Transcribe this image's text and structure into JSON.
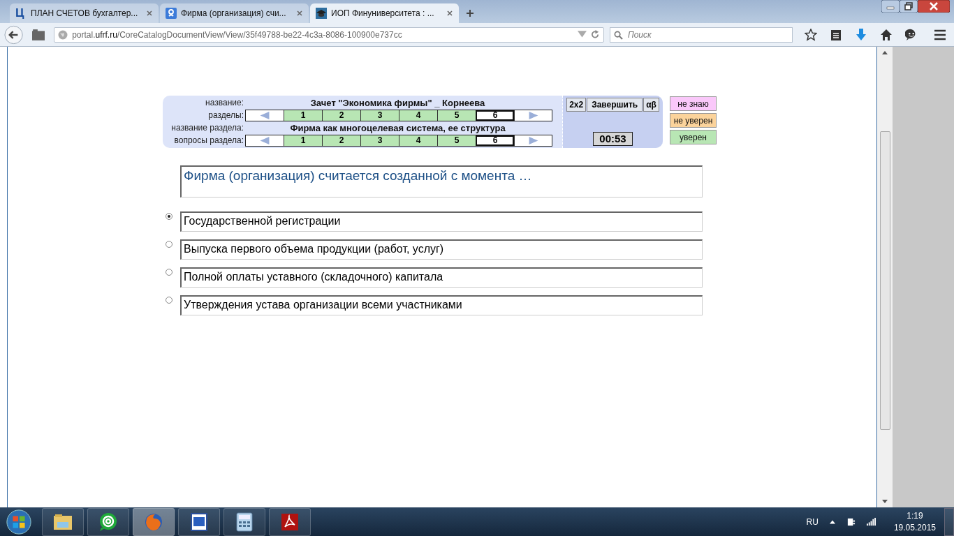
{
  "browser": {
    "tabs": [
      {
        "kind": "letter",
        "favicon_text": "Ц",
        "title": "ПЛАН СЧЕТОВ бухгалтер...",
        "selected": false
      },
      {
        "kind": "search",
        "title": "Фирма (организация) счи...",
        "selected": false
      },
      {
        "kind": "cap",
        "title": "ИОП Финуниверситета : ...",
        "selected": true
      }
    ],
    "url_prefix": "portal.",
    "url_host": "ufrf.ru",
    "url_path": "/CoreCatalogDocumentView/View/35f49788-be22-4c3a-8086-100900e737cc",
    "search": {
      "placeholder": "Поиск"
    }
  },
  "quiz": {
    "name_label": "название:",
    "name": "Зачет \"Экономика фирмы\" _ Корнеева",
    "sections_label": "разделы:",
    "sections": [
      {
        "label": "1",
        "selected": false
      },
      {
        "label": "2",
        "selected": false
      },
      {
        "label": "3",
        "selected": false
      },
      {
        "label": "4",
        "selected": false
      },
      {
        "label": "5",
        "selected": false
      },
      {
        "label": "6",
        "selected": true
      }
    ],
    "section_name_label": "название раздела:",
    "section_name": "Фирма как многоцелевая система, ее структура",
    "questions_label": "вопросы раздела:",
    "questions": [
      {
        "label": "1",
        "selected": false
      },
      {
        "label": "2",
        "selected": false
      },
      {
        "label": "3",
        "selected": false
      },
      {
        "label": "4",
        "selected": false
      },
      {
        "label": "5",
        "selected": false
      },
      {
        "label": "6",
        "selected": true
      }
    ],
    "tools": [
      "2x2",
      "Завершить",
      "αβ"
    ],
    "timer": "00:53",
    "confidence": [
      {
        "label": "не знаю",
        "kind": "unknown"
      },
      {
        "label": "не уверен",
        "kind": "unsure"
      },
      {
        "label": "уверен",
        "kind": "sure"
      }
    ],
    "question": "Фирма (организация) считается созданной с момента …",
    "answers": [
      {
        "text": "Государственной регистрации",
        "selected": true
      },
      {
        "text": "Выпуска первого объема продукции (работ, услуг)",
        "selected": false
      },
      {
        "text": "Полной оплаты уставного (складочного) капитала",
        "selected": false
      },
      {
        "text": "Утверждения  устава организации всеми участниками",
        "selected": false
      }
    ]
  },
  "taskbar": {
    "apps": [
      {
        "kind": "folder",
        "active": false
      },
      {
        "kind": "chat",
        "active": false
      },
      {
        "kind": "browser",
        "active": true
      },
      {
        "kind": "word",
        "active": false
      },
      {
        "kind": "calculator",
        "active": false
      },
      {
        "kind": "pdf",
        "active": false
      }
    ],
    "language": "RU",
    "time": "1:19",
    "date": "19.05.2015"
  }
}
